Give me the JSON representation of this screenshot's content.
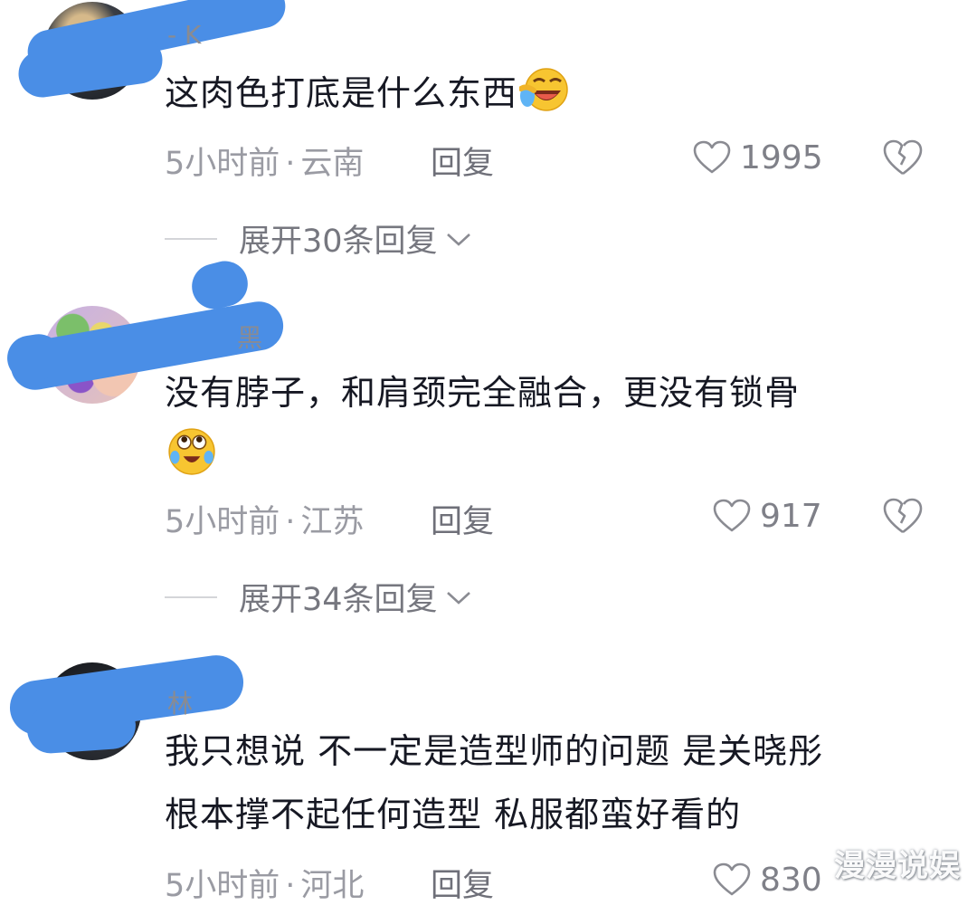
{
  "comments": [
    {
      "username_fragment": "- K",
      "text_lines": [
        "这肉色打底是什么东西"
      ],
      "emoji": "laughing-crying-emoji",
      "time": "5小时前",
      "location": "云南",
      "reply_label": "回复",
      "likes": "1995",
      "expand_label": "展开30条回复"
    },
    {
      "username_fragment": "黑",
      "text_lines": [
        "没有脖子，和肩颈完全融合，更没有锁骨"
      ],
      "emoji": "upward-eyes-emoji",
      "time": "5小时前",
      "location": "江苏",
      "reply_label": "回复",
      "likes": "917",
      "expand_label": "展开34条回复"
    },
    {
      "username_fragment": "林",
      "text_lines": [
        "我只想说 不一定是造型师的问题 是关晓彤",
        "根本撑不起任何造型 私服都蛮好看的"
      ],
      "time": "5小时前",
      "location": "河北",
      "reply_label": "回复",
      "likes": "830"
    }
  ],
  "separator": "·",
  "watermark": "漫漫说娱",
  "colors": {
    "redaction": "#4a8ee6",
    "text": "#161823",
    "meta": "#9a9ba3"
  }
}
